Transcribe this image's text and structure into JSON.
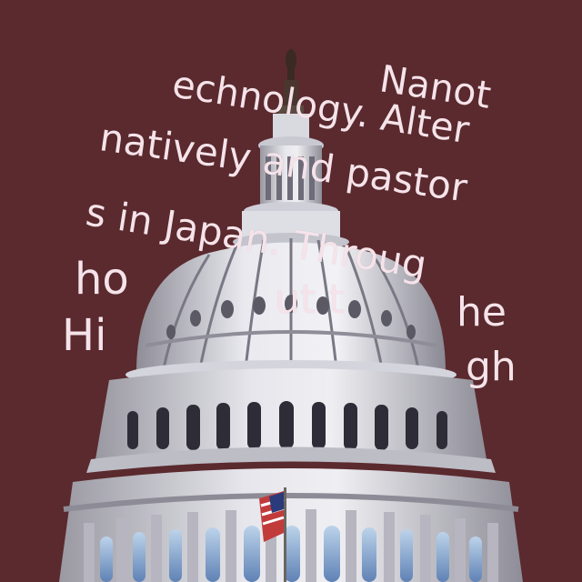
{
  "background_color": "#5a2a2e",
  "text_color": "#f6e3ea",
  "text_fragments": [
    "Nanot",
    "echnology. Alter",
    "natively and pastor",
    "s in Japan. Throug",
    "ho",
    "Hi",
    "ut t",
    "he",
    "gh"
  ],
  "image": {
    "subject": "capitol-dome",
    "has_flag": true
  }
}
